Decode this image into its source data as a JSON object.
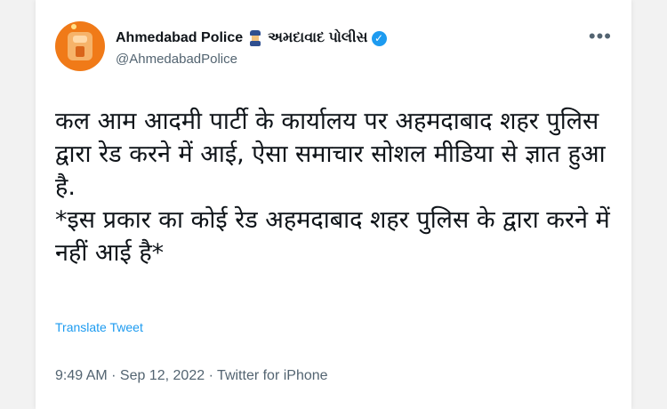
{
  "tweet": {
    "display_name": "Ahmedabad Police",
    "display_name_gujarati": "અમદાવાદ પોલીસ",
    "handle": "@AhmedabadPolice",
    "more_icon": "•••",
    "verified_icon": "✓",
    "text_paragraph_1": "कल आम आदमी पार्टी के कार्यालय पर अहमदाबाद शहर पुलिस द्वारा रेड करने में आई, ऐसा समाचार सोशल मीडिया से ज्ञात हुआ है.",
    "text_paragraph_2": "*इस प्रकार का कोई रेड अहमदाबाद शहर पुलिस के द्वारा करने में नहीं आई है*",
    "translate_label": "Translate Tweet",
    "meta": "9:49 AM · Sep 12, 2022 · Twitter for iPhone"
  },
  "colors": {
    "accent": "#1d9bf0",
    "avatar_bg": "#f07a18",
    "secondary_text": "#536471"
  }
}
